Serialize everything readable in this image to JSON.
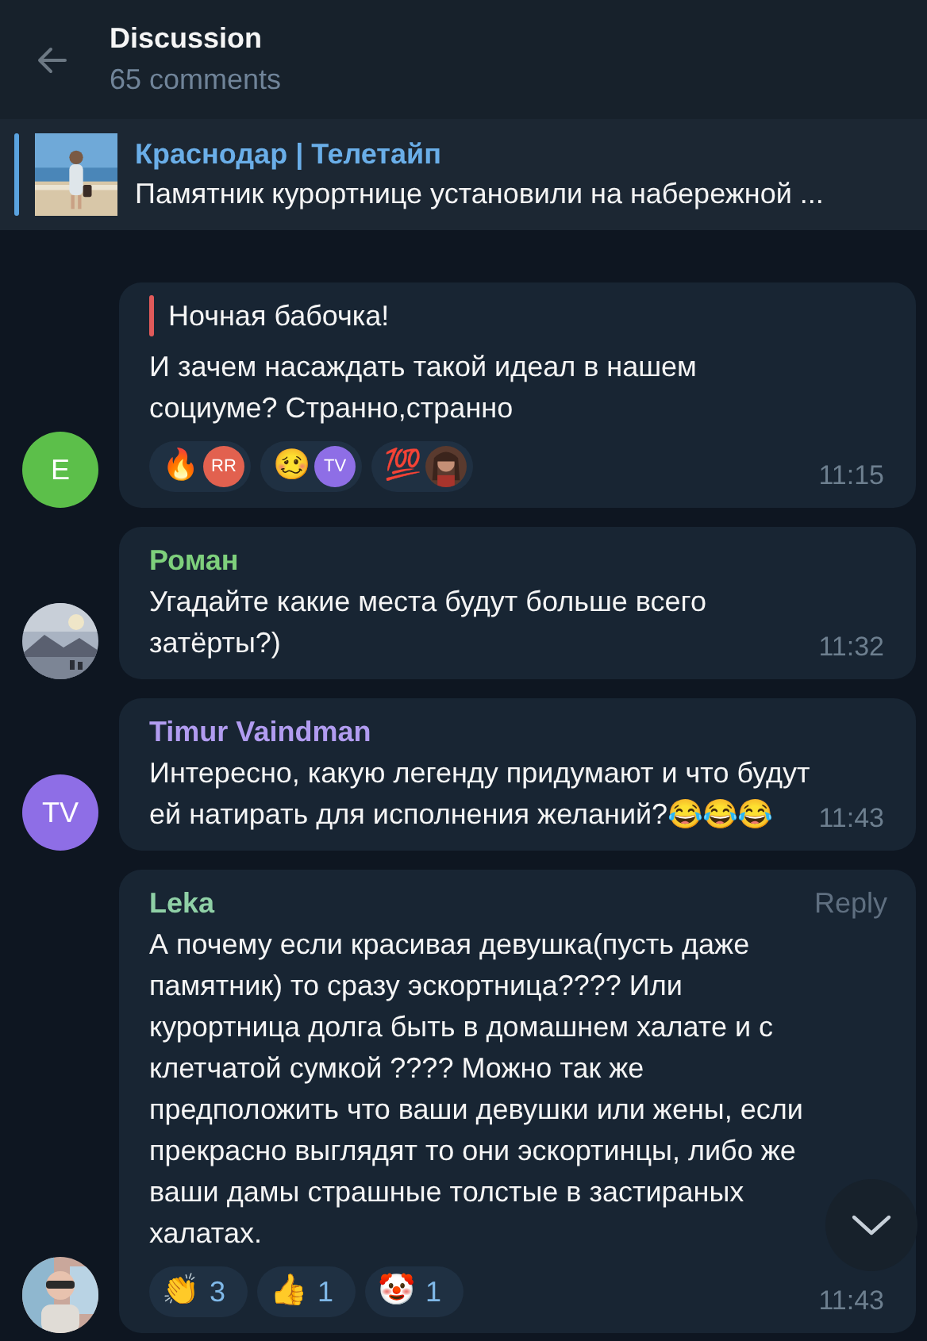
{
  "header": {
    "title": "Discussion",
    "subtitle": "65 comments"
  },
  "pinned": {
    "channel": "Краснодар | Телетайп",
    "text": "Памятник курортнице установили на набережной ...",
    "thumbnail": {
      "kind": "picture"
    }
  },
  "messages": [
    {
      "avatar": {
        "kind": "initials",
        "text": "E",
        "color": "#5cbf4a"
      },
      "quote": "Ночная бабочка!",
      "text": "И зачем насаждать такой идеал в нашем социуме? Странно,странно",
      "reactions": [
        {
          "kind": "avatar",
          "emoji": "🔥",
          "avatar": {
            "kind": "initials",
            "text": "RR",
            "color": "#e2614f"
          }
        },
        {
          "kind": "avatar",
          "emoji": "🥴",
          "avatar": {
            "kind": "initials",
            "text": "TV",
            "color": "#8e6ee6"
          }
        },
        {
          "kind": "avatar",
          "emoji": "💯",
          "avatar": {
            "kind": "picture"
          }
        }
      ],
      "time": "11:15"
    },
    {
      "avatar": {
        "kind": "picture"
      },
      "author": "Роман",
      "color": "#7ed07c",
      "text": "Угадайте какие места будут больше всего затёрты?)",
      "time": "11:32"
    },
    {
      "avatar": {
        "kind": "initials",
        "text": "TV",
        "color": "#8e6ee6"
      },
      "author": "Timur Vaindman",
      "color": "#b19cf0",
      "text": "Интересно, какую легенду придумают и что будут ей натирать для исполнения желаний?😂😂😂",
      "time": "11:43"
    },
    {
      "avatar": {
        "kind": "picture"
      },
      "author": "Leka",
      "color": "#8fd0a6",
      "reply_label": "Reply",
      "text": "А почему если красивая девушка(пусть даже памятник) то сразу эскортница???? Или курортница долга быть в домашнем халате и с клетчатой сумкой ???? Можно так же предположить что ваши девушки или жены, если прекрасно выглядят то они эскортинцы, либо же ваши дамы страшные толстые в застираных халатах.",
      "reactions": [
        {
          "kind": "count",
          "emoji": "👏",
          "count": "3"
        },
        {
          "kind": "count",
          "emoji": "👍",
          "count": "1"
        },
        {
          "kind": "count",
          "emoji": "🤡",
          "count": "1"
        }
      ],
      "time": "11:43"
    }
  ]
}
